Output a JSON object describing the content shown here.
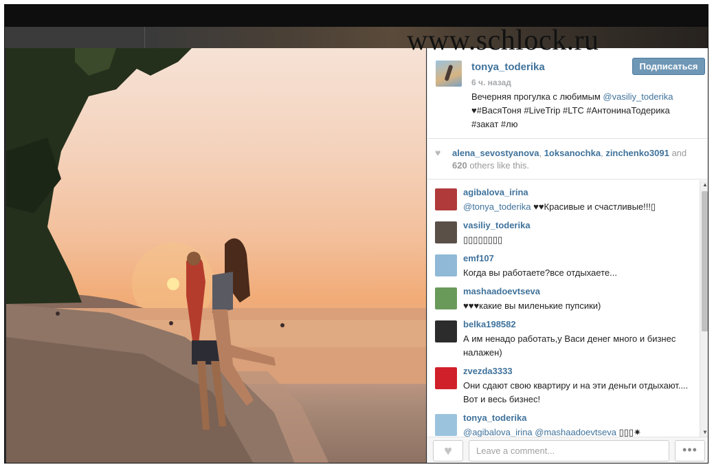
{
  "watermark": "www.schlock.ru",
  "post": {
    "owner": "tonya_toderika",
    "time": "6 ч. назад",
    "follow_label": "Подписаться",
    "caption_prefix": "Вечерняя прогулка с любимым ",
    "caption_mention": "@vasiliy_toderika",
    "caption_rest": "♥#ВасяТоня #LiveTrip #LTC #АнтонинаТодерика #закат #лю"
  },
  "likes": {
    "users": [
      "alena_sevostyanova",
      "1oksanochka",
      "zinchenko3091"
    ],
    "and_label": "and",
    "count": "620",
    "suffix": "others like this."
  },
  "comments": [
    {
      "user": "agibalova_irina",
      "mention": "@tonya_toderika",
      "text": " ♥♥Красивые и счастливые!!!▯",
      "avatar_color": "#b03a3a"
    },
    {
      "user": "vasiliy_toderika",
      "mention": "",
      "text": "▯▯▯▯▯▯▯▯",
      "avatar_color": "#5a5048"
    },
    {
      "user": "emf107",
      "mention": "",
      "text": "Когда вы работаете?все отдыхаете...",
      "avatar_color": "#8fb9d6"
    },
    {
      "user": "mashaadoevtseva",
      "mention": "",
      "text": "♥♥♥какие вы миленькие пупсики)",
      "avatar_color": "#6a9a5a"
    },
    {
      "user": "belka198582",
      "mention": "",
      "text": "А им ненадо работать,у Васи денег много и бизнес налажен)",
      "avatar_color": "#2c2c2c"
    },
    {
      "user": "zvezda3333",
      "mention": "",
      "text": "Они сдают свою квартиру и на эти деньги отдыхают.... Вот и весь бизнес!",
      "avatar_color": "#d0202a"
    },
    {
      "user": "tonya_toderika",
      "mention": "@agibalova_irina @mashaadoevtseva",
      "text": " ▯▯▯✷",
      "avatar_color": "#9cc3de"
    }
  ],
  "footer": {
    "like_icon": "♥",
    "comment_placeholder": "Leave a comment...",
    "more_label": "•••"
  }
}
